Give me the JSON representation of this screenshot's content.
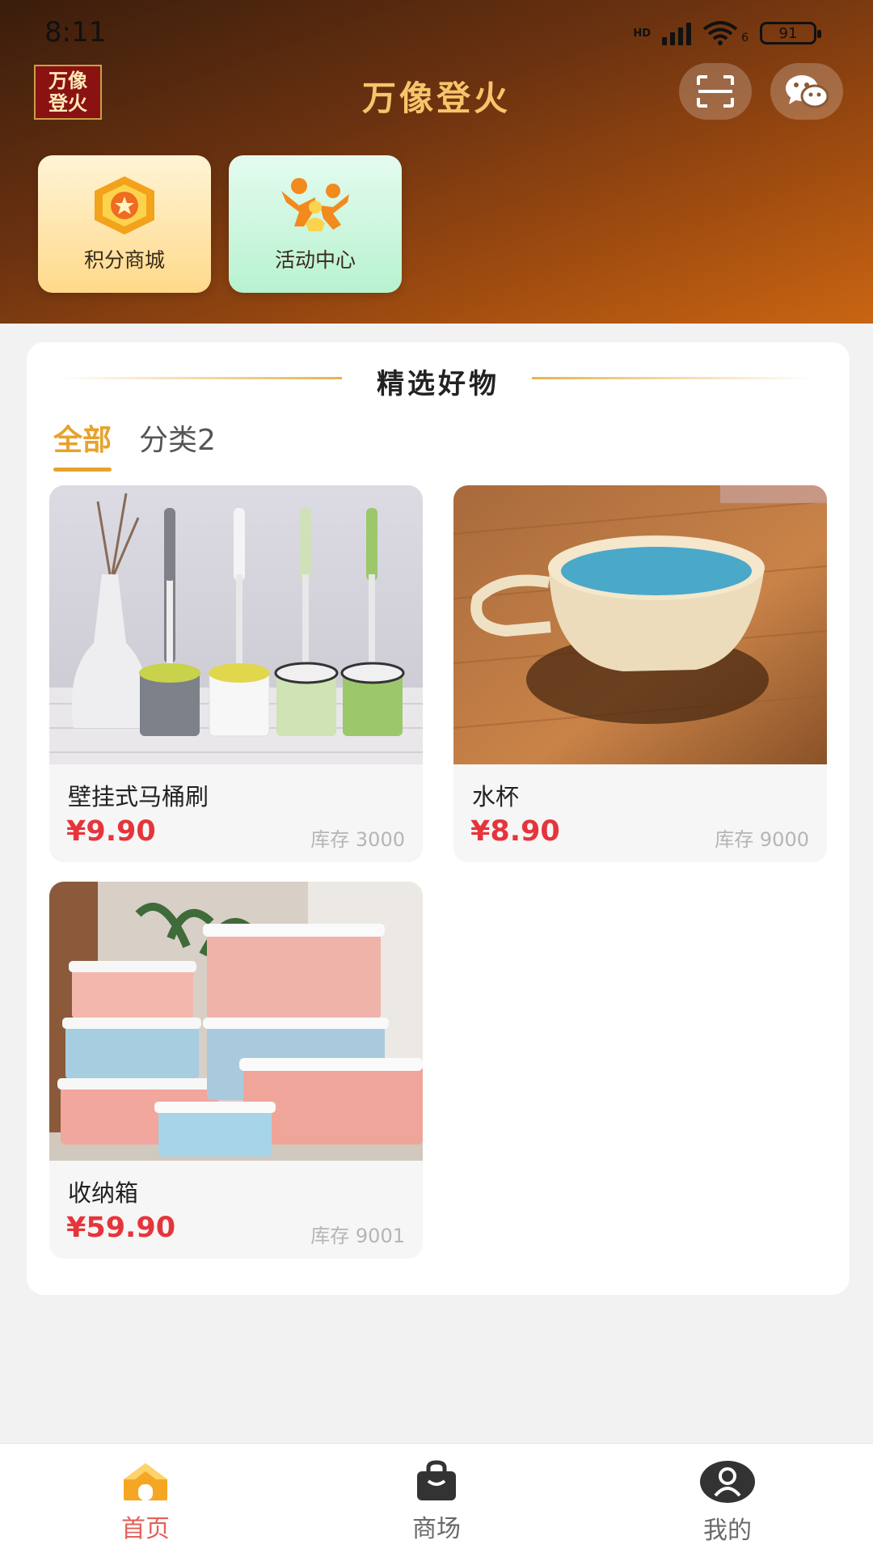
{
  "status_bar": {
    "time": "8:11",
    "battery": "91",
    "network_labels": [
      "HD",
      "6"
    ]
  },
  "header": {
    "logo_line1": "万像",
    "logo_line2": "登火",
    "title": "万像登火",
    "scan_icon": "scan-icon",
    "wechat_icon": "wechat-icon"
  },
  "quick_entries": [
    {
      "label": "积分商城",
      "icon": "points-medal-icon"
    },
    {
      "label": "活动中心",
      "icon": "activity-people-icon"
    }
  ],
  "section": {
    "title": "精选好物",
    "tabs": [
      {
        "label": "全部",
        "active": true
      },
      {
        "label": "分类2",
        "active": false
      }
    ]
  },
  "products": [
    {
      "name": "壁挂式马桶刷",
      "price": "¥9.90",
      "stock": "库存 3000",
      "image": "toilet-brush-photo"
    },
    {
      "name": "水杯",
      "price": "¥8.90",
      "stock": "库存 9000",
      "image": "cup-photo"
    },
    {
      "name": "收纳箱",
      "price": "¥59.90",
      "stock": "库存 9001",
      "image": "storage-box-photo"
    }
  ],
  "tabbar": [
    {
      "label": "首页",
      "icon": "home-icon",
      "active": true
    },
    {
      "label": "商场",
      "icon": "shopping-bag-icon",
      "active": false
    },
    {
      "label": "我的",
      "icon": "user-icon",
      "active": false
    }
  ],
  "colors": {
    "accent": "#e8a22c",
    "price": "#e5353b",
    "title_gold": "#f7c46a",
    "active_tab": "#e5605a"
  }
}
